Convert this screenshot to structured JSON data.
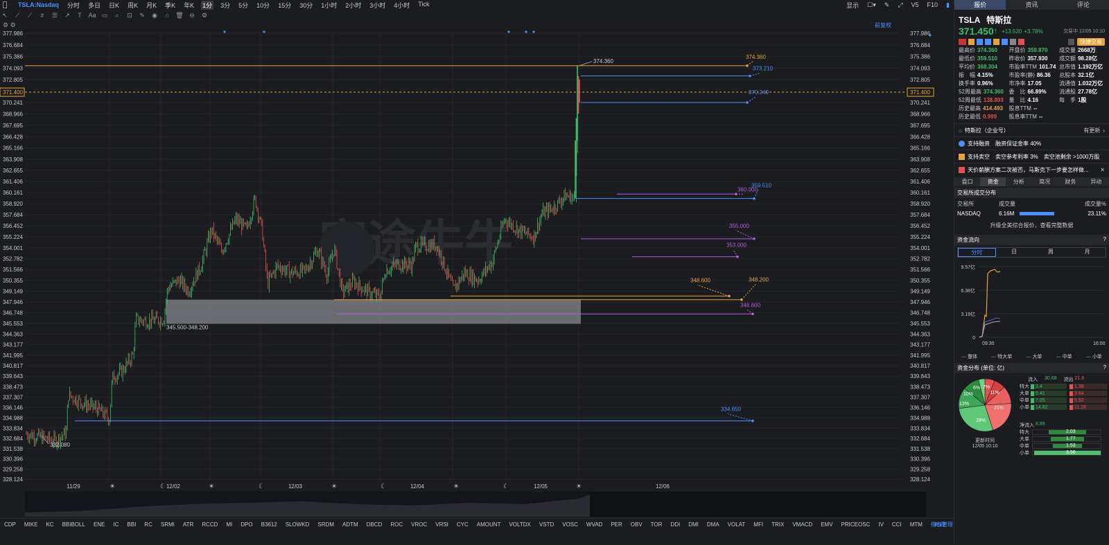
{
  "topbar": {
    "ticker": "TSLA:Nasdaq",
    "periods": [
      "分时",
      "多日",
      "日K",
      "周K",
      "月K",
      "季K",
      "年K",
      "1分",
      "3分",
      "5分",
      "10分",
      "15分",
      "30分",
      "1小时",
      "2小时",
      "3小时",
      "4小时",
      "Tick"
    ],
    "active_period": "1分",
    "display": "显示",
    "v5": "V5",
    "f10": "F10"
  },
  "chart": {
    "restore_label": "前复权",
    "price_axis": [
      "377.986",
      "376.684",
      "375.386",
      "374.093",
      "372.805",
      "371.400",
      "370.241",
      "368.966",
      "367.695",
      "366.428",
      "365.166",
      "363.908",
      "362.655",
      "361.406",
      "360.161",
      "358.920",
      "357.684",
      "356.452",
      "355.224",
      "354.001",
      "352.782",
      "351.566",
      "350.355",
      "349.149",
      "347.946",
      "346.748",
      "345.553",
      "344.363",
      "343.177",
      "341.995",
      "340.817",
      "339.643",
      "338.473",
      "337.307",
      "336.146",
      "334.988",
      "333.834",
      "332.684",
      "331.538",
      "330.396",
      "329.258",
      "328.124"
    ],
    "current_price": "371.400",
    "date_labels": [
      "11/29",
      "12/02",
      "12/03",
      "12/04",
      "12/05",
      "12/06"
    ],
    "annotations": {
      "high": "374.360",
      "low": "332.080",
      "zone": "345.500-348.200"
    },
    "levels": [
      {
        "value": "374.360",
        "color": "#e8a33a"
      },
      {
        "value": "373.210",
        "color": "#4a90ff"
      },
      {
        "value": "370.240",
        "color": "#4a90ff"
      },
      {
        "value": "360.000",
        "color": "#b45ee0"
      },
      {
        "value": "359.510",
        "color": "#4a90ff"
      },
      {
        "value": "355.000",
        "color": "#b45ee0"
      },
      {
        "value": "353.000",
        "color": "#b45ee0"
      },
      {
        "value": "348.600",
        "color": "#e8a33a"
      },
      {
        "value": "348.200",
        "color": "#e8a33a"
      },
      {
        "value": "346.600",
        "color": "#b45ee0"
      },
      {
        "value": "334.650",
        "color": "#4a90ff"
      }
    ],
    "watermark": "富途牛牛"
  },
  "indicators": [
    "CDP",
    "MIKE",
    "KC",
    "BBIBOLL",
    "ENE",
    "IC",
    "BBI",
    "RC",
    "SRMI",
    "ATR",
    "RCCD",
    "MI",
    "DPO",
    "B3612",
    "SLOWKD",
    "SRDM",
    "ADTM",
    "DBCD",
    "ROC",
    "VROC",
    "VRSI",
    "CYC",
    "AMOUNT",
    "VOLTDX",
    "VSTD",
    "VOSC",
    "WVAD",
    "PER",
    "OBV",
    "TOR",
    "DDI",
    "DMI",
    "DMA",
    "VOLAT",
    "MFI",
    "TRIX",
    "VMACD",
    "EMV",
    "PRICEOSC",
    "IV",
    "CCI",
    "MTM"
  ],
  "indicator_manage": "指标管理",
  "indicator_tail": "时段",
  "side": {
    "tabs": [
      "报价",
      "资讯",
      "评论"
    ],
    "active_tab": "报价",
    "symbol": "TSLA",
    "name": "特斯拉",
    "price": "371.450",
    "arrow": "↑",
    "change": "+13.520",
    "change_pct": "+3.78%",
    "time": "交易中 12/05 10:10",
    "quick_trade": "快捷交易",
    "quote": [
      [
        "最高价",
        "374.360",
        "开盘价",
        "359.870",
        "成交量",
        "2668万"
      ],
      [
        "最低价",
        "359.510",
        "昨收价",
        "357.930",
        "成交额",
        "98.28亿"
      ],
      [
        "平均价",
        "368.304",
        "市盈率TTM",
        "101.74",
        "总市值",
        "1.192万亿"
      ],
      [
        "振　幅",
        "4.15%",
        "市盈率(静)",
        "86.36",
        "总股本",
        "32.1亿"
      ],
      [
        "换手率",
        "0.96%",
        "市净率",
        "17.05",
        "流通值",
        "1.032万亿"
      ],
      [
        "52周最高",
        "374.360",
        "委　比",
        "66.89%",
        "流通股",
        "27.78亿"
      ],
      [
        "52周最低",
        "138.803",
        "量　比",
        "4.16",
        "每　手",
        "1股"
      ],
      [
        "历史最高",
        "414.493",
        "股息TTM",
        "--",
        "",
        ""
      ],
      [
        "历史最低",
        "0.999",
        "股息率TTM",
        "--",
        "",
        ""
      ]
    ],
    "company_row": {
      "label": "特斯拉（企业号）",
      "right": "有更新"
    },
    "margin_row": {
      "a": "支持融资",
      "b": "融资保证金率 40%"
    },
    "short_row": {
      "a": "支持卖空",
      "b": "卖空参考利率 3%",
      "c": "卖空池剩余 >1000万股"
    },
    "news_row": "天价薪酬方案二次被否，马斯克下一步要怎样做...",
    "sub_tabs": [
      "盘口",
      "资金",
      "分析",
      "简况",
      "财务",
      "异动"
    ],
    "active_sub": "资金",
    "exchange": {
      "title": "交易所成交分布",
      "headers": [
        "交易所",
        "成交量",
        "成交量%"
      ],
      "row": [
        "NASDAQ",
        "6.16M",
        "23.11%"
      ],
      "upgrade": "升级全美综合报价，查看完整数据"
    },
    "flow": {
      "title": "资金流向",
      "tabs": [
        "分时",
        "日",
        "周",
        "月"
      ],
      "active": "分时",
      "y_labels": [
        "9.57亿",
        "6.38亿",
        "3.19亿",
        "0"
      ],
      "x_labels": [
        "09:30",
        "16:00"
      ],
      "legend": [
        "整体",
        "特大单",
        "大单",
        "中单",
        "小单"
      ]
    },
    "dist": {
      "title": "资金分布 (单位: 亿)",
      "inflow_label": "流入",
      "inflow": "30.68",
      "outflow_label": "流出",
      "outflow": "21.8",
      "rows": [
        {
          "label": "特大",
          "in": "3.4",
          "out": "1.38"
        },
        {
          "label": "大单",
          "in": "5.41",
          "out": "3.64"
        },
        {
          "label": "中单",
          "in": "7.05",
          "out": "5.52"
        },
        {
          "label": "小单",
          "in": "14.82",
          "out": "11.26"
        }
      ],
      "pie_labels": [
        "6%",
        "7%",
        "11%",
        "10%",
        "13%",
        "21%",
        "28%"
      ],
      "net_label": "净流入",
      "net": "8.89",
      "net_rows": [
        {
          "label": "特大",
          "value": "2.03"
        },
        {
          "label": "大单",
          "value": "1.77"
        },
        {
          "label": "中单",
          "value": "1.53"
        },
        {
          "label": "小单",
          "value": "3.56"
        }
      ],
      "update_label": "更新时间",
      "update_time": "12/05 10:10"
    }
  },
  "colors": {
    "up": "#3fbf6b",
    "down": "#e45151",
    "accent": "#4a90ff",
    "orange": "#e8a33a",
    "purple": "#b45ee0"
  }
}
